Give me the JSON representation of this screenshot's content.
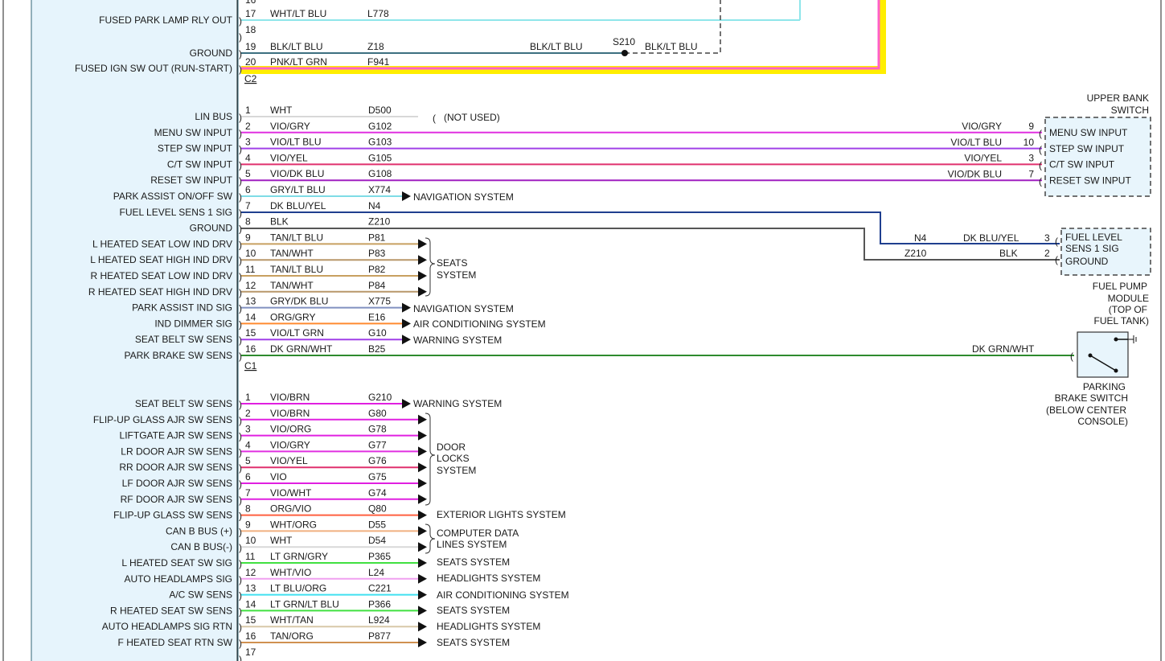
{
  "c2": {
    "connector": "C2",
    "pins": [
      {
        "label": "FUSED PARK LAMP RLY OUT",
        "pin": "17",
        "color": "WHT/LT BLU",
        "circuit": "L778"
      },
      {
        "label": "",
        "pin": "18",
        "color": "",
        "circuit": ""
      },
      {
        "label": "GROUND",
        "pin": "19",
        "color": "BLK/LT BLU",
        "circuit": "Z18"
      },
      {
        "label": "FUSED IGN SW OUT (RUN-START)",
        "pin": "20",
        "color": "PNK/LT GRN",
        "circuit": "F941"
      }
    ],
    "top_pin": "16",
    "splice": {
      "name": "S210",
      "left_color": "BLK/LT BLU",
      "right_color": "BLK/LT BLU"
    }
  },
  "c1": {
    "connector": "C1",
    "pins": [
      {
        "label": "LIN BUS",
        "pin": "1",
        "color": "WHT",
        "circuit": "D500"
      },
      {
        "label": "MENU SW INPUT",
        "pin": "2",
        "color": "VIO/GRY",
        "circuit": "G102"
      },
      {
        "label": "STEP SW INPUT",
        "pin": "3",
        "color": "VIO/LT BLU",
        "circuit": "G103"
      },
      {
        "label": "C/T SW INPUT",
        "pin": "4",
        "color": "VIO/YEL",
        "circuit": "G105"
      },
      {
        "label": "RESET SW INPUT",
        "pin": "5",
        "color": "VIO/DK BLU",
        "circuit": "G108"
      },
      {
        "label": "PARK ASSIST ON/OFF SW",
        "pin": "6",
        "color": "GRY/LT BLU",
        "circuit": "X774"
      },
      {
        "label": "FUEL LEVEL SENS 1 SIG",
        "pin": "7",
        "color": "DK BLU/YEL",
        "circuit": "N4"
      },
      {
        "label": "GROUND",
        "pin": "8",
        "color": "BLK",
        "circuit": "Z210"
      },
      {
        "label": "L HEATED SEAT LOW IND DRV",
        "pin": "9",
        "color": "TAN/LT BLU",
        "circuit": "P81"
      },
      {
        "label": "L HEATED SEAT HIGH IND DRV",
        "pin": "10",
        "color": "TAN/WHT",
        "circuit": "P83"
      },
      {
        "label": "R HEATED SEAT LOW IND DRV",
        "pin": "11",
        "color": "TAN/LT BLU",
        "circuit": "P82"
      },
      {
        "label": "R HEATED SEAT HIGH IND DRV",
        "pin": "12",
        "color": "TAN/WHT",
        "circuit": "P84"
      },
      {
        "label": "PARK ASSIST IND SIG",
        "pin": "13",
        "color": "GRY/DK BLU",
        "circuit": "X775"
      },
      {
        "label": "IND DIMMER SIG",
        "pin": "14",
        "color": "ORG/GRY",
        "circuit": "E16"
      },
      {
        "label": "SEAT BELT SW SENS",
        "pin": "15",
        "color": "VIO/LT GRN",
        "circuit": "G10"
      },
      {
        "label": "PARK BRAKE SW SENS",
        "pin": "16",
        "color": "DK GRN/WHT",
        "circuit": "B25"
      }
    ],
    "not_used": "(NOT USED)",
    "dest_navigation": "NAVIGATION SYSTEM",
    "dest_seats_line1": "SEATS",
    "dest_seats_line2": "SYSTEM",
    "dest_ac": "AIR CONDITIONING SYSTEM",
    "dest_warning": "WARNING SYSTEM"
  },
  "c3": {
    "pins": [
      {
        "label": "SEAT BELT SW SENS",
        "pin": "1",
        "color": "VIO/BRN",
        "circuit": "G210"
      },
      {
        "label": "FLIP-UP GLASS AJR SW SENS",
        "pin": "2",
        "color": "VIO/BRN",
        "circuit": "G80"
      },
      {
        "label": "LIFTGATE AJR SW SENS",
        "pin": "3",
        "color": "VIO/ORG",
        "circuit": "G78"
      },
      {
        "label": "LR DOOR AJR SW SENS",
        "pin": "4",
        "color": "VIO/GRY",
        "circuit": "G77"
      },
      {
        "label": "RR DOOR AJR SW SENS",
        "pin": "5",
        "color": "VIO/YEL",
        "circuit": "G76"
      },
      {
        "label": "LF DOOR AJR SW SENS",
        "pin": "6",
        "color": "VIO",
        "circuit": "G75"
      },
      {
        "label": "RF DOOR AJR SW SENS",
        "pin": "7",
        "color": "VIO/WHT",
        "circuit": "G74"
      },
      {
        "label": "FLIP-UP GLASS SW SENS",
        "pin": "8",
        "color": "ORG/VIO",
        "circuit": "Q80"
      },
      {
        "label": "CAN B BUS (+)",
        "pin": "9",
        "color": "WHT/ORG",
        "circuit": "D55"
      },
      {
        "label": "CAN B BUS(-)",
        "pin": "10",
        "color": "WHT",
        "circuit": "D54"
      },
      {
        "label": "L HEATED SEAT SW SIG",
        "pin": "11",
        "color": "LT GRN/GRY",
        "circuit": "P365"
      },
      {
        "label": "AUTO HEADLAMPS SIG",
        "pin": "12",
        "color": "WHT/VIO",
        "circuit": "L24"
      },
      {
        "label": "A/C SW SENS",
        "pin": "13",
        "color": "LT BLU/ORG",
        "circuit": "C221"
      },
      {
        "label": "R HEATED SEAT SW SENS",
        "pin": "14",
        "color": "LT GRN/LT BLU",
        "circuit": "P366"
      },
      {
        "label": "AUTO HEADLAMPS SIG RTN",
        "pin": "15",
        "color": "WHT/TAN",
        "circuit": "L924"
      },
      {
        "label": "F HEATED SEAT RTN SW",
        "pin": "16",
        "color": "TAN/ORG",
        "circuit": "P877"
      },
      {
        "label": "",
        "pin": "17",
        "color": "",
        "circuit": ""
      }
    ],
    "dest_warning": "WARNING SYSTEM",
    "dest_door_line1": "DOOR",
    "dest_door_line2": "LOCKS",
    "dest_door_line3": "SYSTEM",
    "dest_exterior": "EXTERIOR LIGHTS SYSTEM",
    "dest_computer_line1": "COMPUTER DATA",
    "dest_computer_line2": "LINES SYSTEM",
    "dest_seats": "SEATS SYSTEM",
    "dest_headlights": "HEADLIGHTS SYSTEM",
    "dest_ac": "AIR CONDITIONING SYSTEM"
  },
  "upper_bank": {
    "title_line1": "UPPER BANK",
    "title_line2": "SWITCH",
    "pins": [
      {
        "color": "VIO/GRY",
        "pin": "9",
        "label": "MENU SW INPUT"
      },
      {
        "color": "VIO/LT BLU",
        "pin": "10",
        "label": "STEP SW INPUT"
      },
      {
        "color": "VIO/YEL",
        "pin": "3",
        "label": "C/T SW INPUT"
      },
      {
        "color": "VIO/DK BLU",
        "pin": "7",
        "label": "RESET SW INPUT"
      }
    ]
  },
  "fuel_pump": {
    "pins": [
      {
        "circuit": "N4",
        "color": "DK BLU/YEL",
        "pin": "3",
        "label": "FUEL LEVEL"
      },
      {
        "circuit": "Z210",
        "color": "BLK",
        "pin": "2",
        "label": "GROUND"
      }
    ],
    "label_line2": "SENS 1 SIG",
    "title_line1": "FUEL PUMP",
    "title_line2": "MODULE",
    "title_line3": "(TOP OF",
    "title_line4": "FUEL TANK)"
  },
  "parking_brake": {
    "wire_color": "DK GRN/WHT",
    "title_line1": "PARKING",
    "title_line2": "BRAKE SWITCH",
    "title_line3": "(BELOW CENTER",
    "title_line4": "CONSOLE)"
  },
  "wire_colors": {
    "WHT": "#d8d8d8",
    "WHT/LT BLU": "#8fe6ea",
    "BLK/LT BLU": "#3c6f80",
    "PNK/LT GRN": "#ff5fc8",
    "VIO/GRY": "#e030e0",
    "VIO/LT BLU": "#a040e8",
    "VIO/YEL": "#e0306e",
    "VIO/DK BLU": "#a020c0",
    "GRY/LT BLU": "#7fdce6",
    "DK BLU/YEL": "#1f3f8f",
    "BLK": "#555555",
    "TAN/LT BLU": "#c8a060",
    "TAN/WHT": "#b8976a",
    "GRY/DK BLU": "#8090c0",
    "ORG/GRY": "#ff8a30",
    "VIO/LT GRN": "#a040e8",
    "DK GRN/WHT": "#2e8b2e",
    "VIO/BRN": "#e020e0",
    "VIO/ORG": "#e020e0",
    "VIO": "#e020e0",
    "VIO/WHT": "#e020e0",
    "ORG/VIO": "#ff6040",
    "WHT/ORG": "#f0b080",
    "LT GRN/GRY": "#40e040",
    "WHT/VIO": "#f0a0f0",
    "LT BLU/ORG": "#40e0f0",
    "LT GRN/LT BLU": "#40e040",
    "WHT/TAN": "#d8c8a8",
    "TAN/ORG": "#d09050",
    "yellow": "#ffee00",
    "module_fill": "#e8f5fc",
    "module_edge": "#336677"
  }
}
